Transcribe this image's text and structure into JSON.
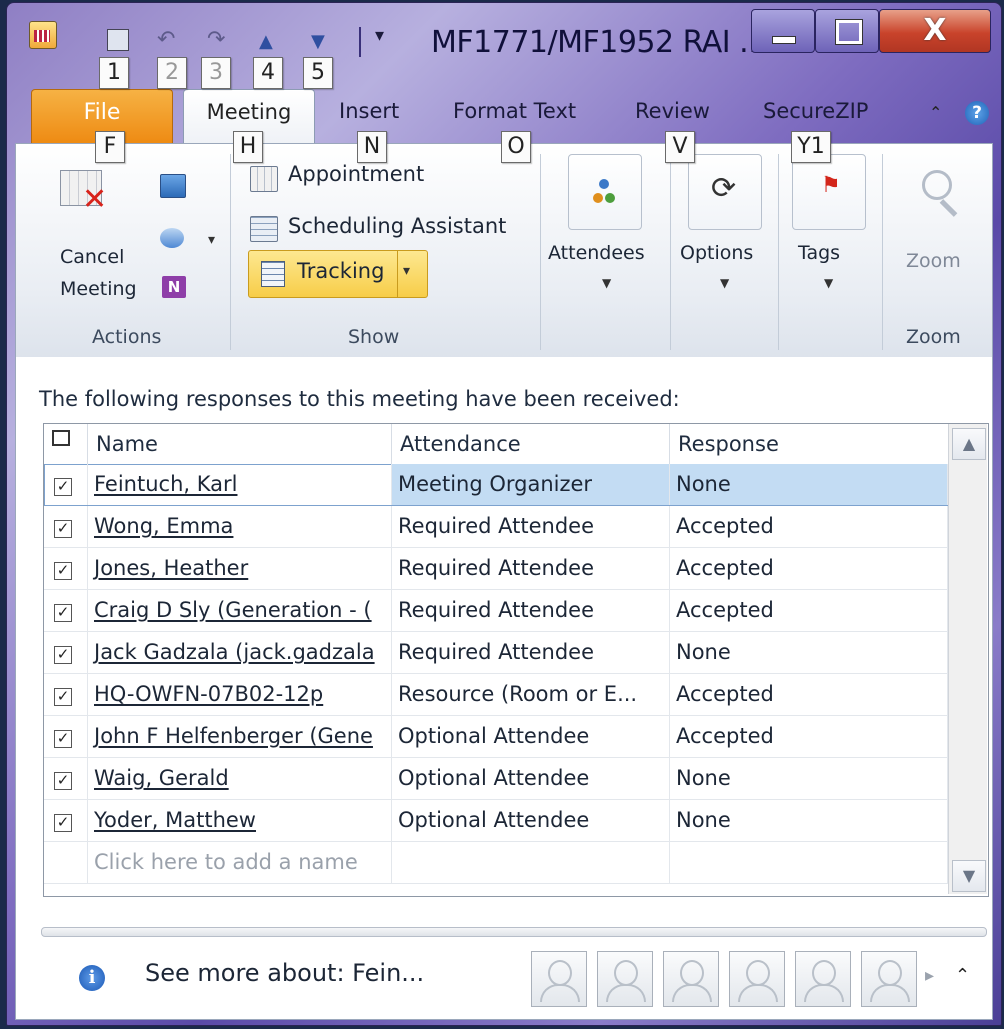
{
  "window": {
    "title": "MF1771/MF1952 RAI ...",
    "qat_keytips": [
      "1",
      "2",
      "3",
      "4",
      "5"
    ]
  },
  "tabs": [
    {
      "label": "File",
      "keytip": "F"
    },
    {
      "label": "Meeting",
      "keytip": "H"
    },
    {
      "label": "Insert",
      "keytip": "N"
    },
    {
      "label": "Format Text",
      "keytip": "O"
    },
    {
      "label": "Review",
      "keytip": "V"
    },
    {
      "label": "SecureZIP",
      "keytip": "Y1"
    }
  ],
  "ribbon": {
    "actions": {
      "cancel_label_1": "Cancel",
      "cancel_label_2": "Meeting",
      "group_label": "Actions"
    },
    "show": {
      "appointment": "Appointment",
      "scheduling": "Scheduling Assistant",
      "tracking": "Tracking",
      "group_label": "Show"
    },
    "attendees": "Attendees",
    "options": "Options",
    "tags": "Tags",
    "zoom": {
      "button": "Zoom",
      "group_label": "Zoom"
    }
  },
  "tracking": {
    "caption": "The following responses to this meeting have been received:",
    "columns": [
      "Name",
      "Attendance",
      "Response"
    ],
    "rows": [
      {
        "name": "Feintuch, Karl",
        "attendance": "Meeting Organizer",
        "response": "None"
      },
      {
        "name": "Wong, Emma",
        "attendance": "Required Attendee",
        "response": "Accepted"
      },
      {
        "name": "Jones, Heather",
        "attendance": "Required Attendee",
        "response": "Accepted"
      },
      {
        "name": "Craig D Sly (Generation - (",
        "attendance": "Required Attendee",
        "response": "Accepted"
      },
      {
        "name": "Jack Gadzala (jack.gadzala",
        "attendance": "Required Attendee",
        "response": "None"
      },
      {
        "name": "HQ-OWFN-07B02-12p",
        "attendance": "Resource (Room or E...",
        "response": "Accepted"
      },
      {
        "name": "John F Helfenberger (Gene",
        "attendance": "Optional Attendee",
        "response": "Accepted"
      },
      {
        "name": "Waig, Gerald",
        "attendance": "Optional Attendee",
        "response": "None"
      },
      {
        "name": "Yoder, Matthew",
        "attendance": "Optional Attendee",
        "response": "None"
      }
    ],
    "add_placeholder": "Click here to add a name"
  },
  "people_pane": {
    "see_more": "See more about: Fein..."
  }
}
